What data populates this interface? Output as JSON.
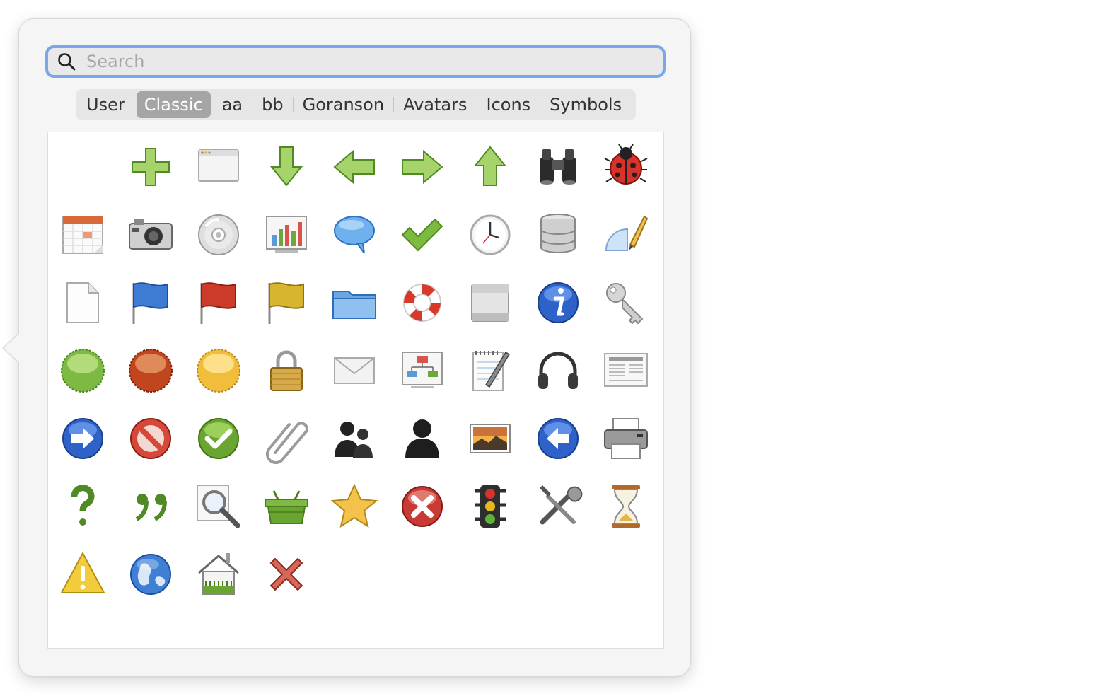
{
  "search": {
    "placeholder": "Search",
    "value": ""
  },
  "tabs": [
    {
      "label": "User",
      "active": false
    },
    {
      "label": "Classic",
      "active": true
    },
    {
      "label": "aa",
      "active": false
    },
    {
      "label": "bb",
      "active": false
    },
    {
      "label": "Goranson",
      "active": false
    },
    {
      "label": "Avatars",
      "active": false
    },
    {
      "label": "Icons",
      "active": false
    },
    {
      "label": "Symbols",
      "active": false
    }
  ],
  "icons": [
    "blank",
    "add-icon",
    "window-icon",
    "arrow-down-icon",
    "arrow-left-icon",
    "arrow-right-icon",
    "arrow-up-icon",
    "binoculars-icon",
    "ladybug-icon",
    "calendar-icon",
    "camera-icon",
    "cd-icon",
    "chart-icon",
    "speech-bubble-icon",
    "checkmark-icon",
    "clock-icon",
    "database-icon",
    "protractor-pencil-icon",
    "document-icon",
    "blue-flag-icon",
    "red-flag-icon",
    "yellow-flag-icon",
    "folder-icon",
    "lifebuoy-icon",
    "box-icon",
    "info-icon",
    "key-icon",
    "green-seal-icon",
    "red-seal-icon",
    "yellow-seal-icon",
    "padlock-icon",
    "envelope-icon",
    "org-chart-icon",
    "notepad-icon",
    "headphones-icon",
    "newspaper-icon",
    "next-icon",
    "stop-icon",
    "ok-icon",
    "paperclip-icon",
    "people-icon",
    "person-icon",
    "picture-icon",
    "previous-icon",
    "printer-icon",
    "question-icon",
    "quote-icon",
    "magnifier-icon",
    "basket-icon",
    "star-icon",
    "cancel-icon",
    "traffic-light-icon",
    "tools-icon",
    "hourglass-icon",
    "warning-icon",
    "globe-icon",
    "home-icon",
    "delete-icon"
  ],
  "colors": {
    "accent": "#7aa7ec",
    "active_tab": "#a5a5a5",
    "green": "#6ea73a",
    "blue": "#2f62c8",
    "red": "#c0392b",
    "yellow": "#e8b935"
  }
}
